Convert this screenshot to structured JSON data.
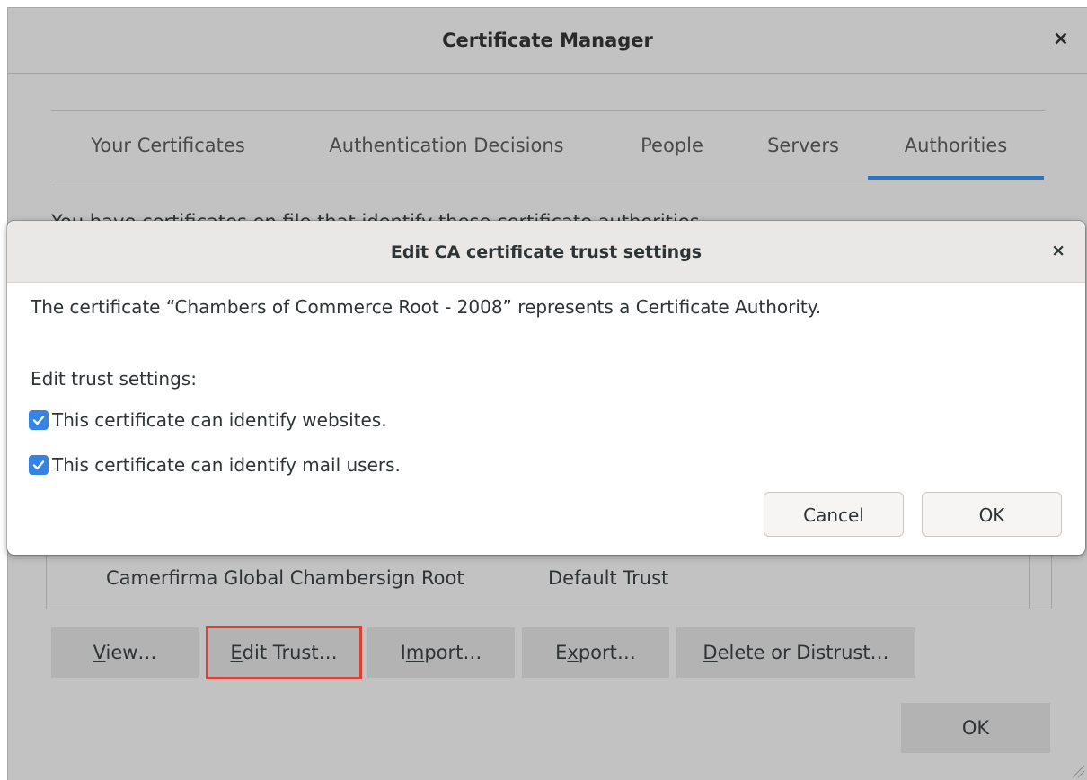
{
  "main_window": {
    "title": "Certificate Manager",
    "close_glyph": "×",
    "tabs": [
      {
        "label": "Your Certificates",
        "active": false
      },
      {
        "label": "Authentication Decisions",
        "active": false
      },
      {
        "label": "People",
        "active": false
      },
      {
        "label": "Servers",
        "active": false
      },
      {
        "label": "Authorities",
        "active": true
      }
    ],
    "hint": "You have certificates on file that identify these certificate authorities",
    "list_row": {
      "name": "Camerfirma Global Chambersign Root",
      "trust": "Default Trust"
    },
    "buttons": {
      "view_mnemonic": "V",
      "view_rest": "iew…",
      "edit_mnemonic": "E",
      "edit_rest": "dit Trust…",
      "import_pre": "I",
      "import_mnemonic": "m",
      "import_rest": "port…",
      "export_pre": "E",
      "export_mnemonic": "x",
      "export_rest": "port…",
      "delete_mnemonic": "D",
      "delete_rest": "elete or Distrust…",
      "ok": "OK"
    }
  },
  "dialog": {
    "title": "Edit CA certificate trust settings",
    "close_glyph": "×",
    "description": "The certificate “Chambers of Commerce Root - 2008” represents a Certificate Authority.",
    "subheading": "Edit trust settings:",
    "checkboxes": [
      {
        "label": "This certificate can identify websites.",
        "checked": true
      },
      {
        "label": "This certificate can identify mail users.",
        "checked": true
      }
    ],
    "cancel_label": "Cancel",
    "ok_label": "OK"
  },
  "colors": {
    "accent_tab": "#2a76c6",
    "checkbox": "#3584e4",
    "highlight_outline": "#d9403a"
  },
  "icons": {
    "close": "close-icon",
    "checkmark": "checkmark-icon",
    "resize": "resize-grip-icon"
  }
}
